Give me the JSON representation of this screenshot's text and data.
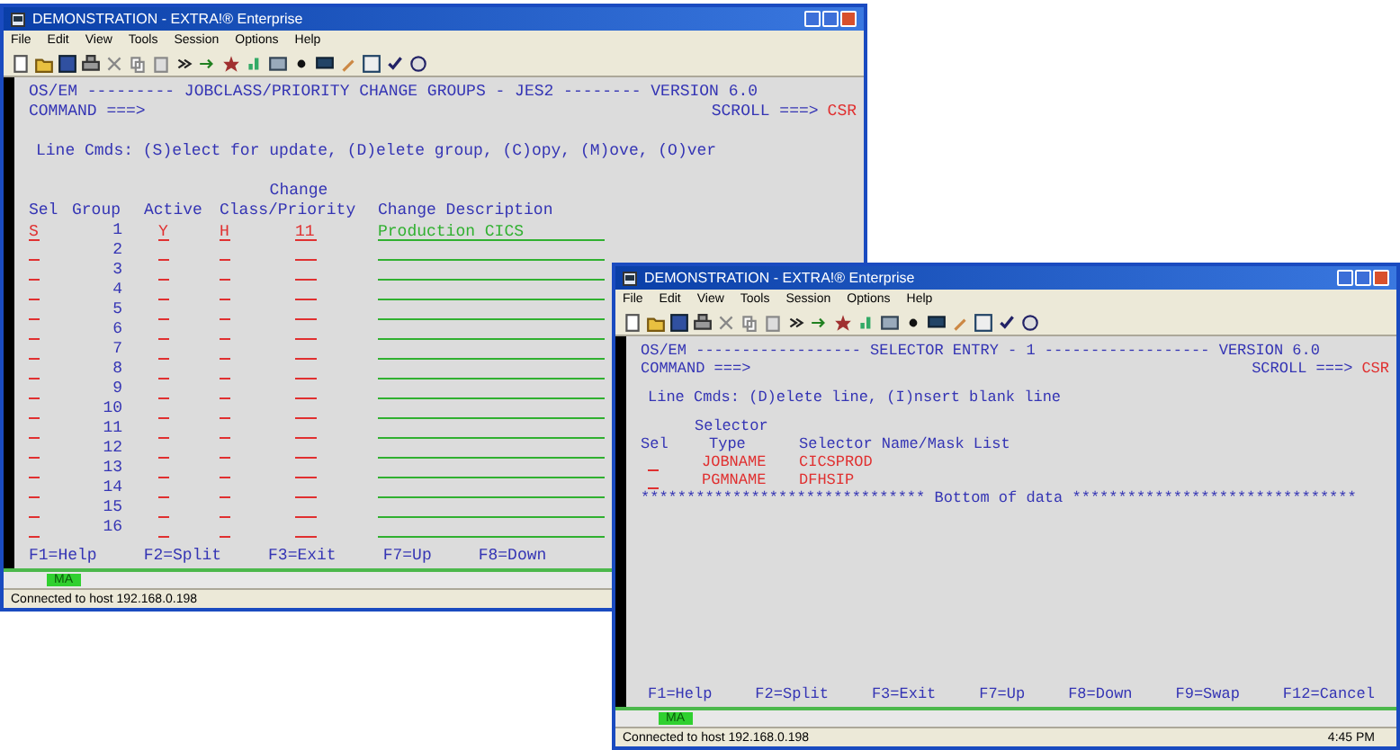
{
  "back_window": {
    "title": "DEMONSTRATION - EXTRA!® Enterprise",
    "menu": [
      "File",
      "Edit",
      "View",
      "Tools",
      "Session",
      "Options",
      "Help"
    ],
    "terminal": {
      "header": "OS/EM --------- JOBCLASS/PRIORITY CHANGE GROUPS - JES2 -------- VERSION 6.0",
      "command": "COMMAND ===>",
      "scroll_label": "SCROLL ===>",
      "scroll_value": "CSR",
      "line_cmds": "Line Cmds: (S)elect for update, (D)elete group, (C)opy, (M)ove, (O)ver",
      "column_group_label": "Change",
      "columns": [
        "Sel",
        "Group",
        "Active",
        "Class/Priority",
        "Change Description"
      ],
      "rows": [
        {
          "sel": "S",
          "group": "1",
          "active": "Y",
          "class": "H",
          "priority": "11",
          "description": "Production CICS"
        },
        {
          "group": "2"
        },
        {
          "group": "3"
        },
        {
          "group": "4"
        },
        {
          "group": "5"
        },
        {
          "group": "6"
        },
        {
          "group": "7"
        },
        {
          "group": "8"
        },
        {
          "group": "9"
        },
        {
          "group": "10"
        },
        {
          "group": "11"
        },
        {
          "group": "12"
        },
        {
          "group": "13"
        },
        {
          "group": "14"
        },
        {
          "group": "15"
        },
        {
          "group": "16"
        }
      ]
    },
    "function_keys": [
      "F1=Help",
      "F2=Split",
      "F3=Exit",
      "F7=Up",
      "F8=Down"
    ],
    "oia": {
      "indicator": "MA"
    },
    "status": {
      "connection": "Connected to host 192.168.0.198"
    }
  },
  "front_window": {
    "title": "DEMONSTRATION - EXTRA!® Enterprise",
    "menu": [
      "File",
      "Edit",
      "View",
      "Tools",
      "Session",
      "Options",
      "Help"
    ],
    "terminal": {
      "header": "OS/EM ------------------ SELECTOR ENTRY - 1 ------------------ VERSION 6.0",
      "command": "COMMAND ===>",
      "scroll_label": "SCROLL ===>",
      "scroll_value": "CSR",
      "line_cmds": "Line Cmds: (D)elete line, (I)nsert blank line",
      "column_group_label": "Selector",
      "columns": [
        "Sel",
        "Type",
        "Selector Name/Mask List"
      ],
      "rows": [
        {
          "type": "JOBNAME",
          "name": "CICSPROD"
        },
        {
          "type": "PGMNAME",
          "name": "DFHSIP"
        }
      ],
      "bottom_marker": "******************************* Bottom of data *******************************"
    },
    "function_keys": [
      "F1=Help",
      "F2=Split",
      "F3=Exit",
      "F7=Up",
      "F8=Down",
      "F9=Swap",
      "F12=Cancel"
    ],
    "oia": {
      "indicator": "MA"
    },
    "status": {
      "connection": "Connected to host 192.168.0.198",
      "time": "4:45 PM"
    }
  }
}
